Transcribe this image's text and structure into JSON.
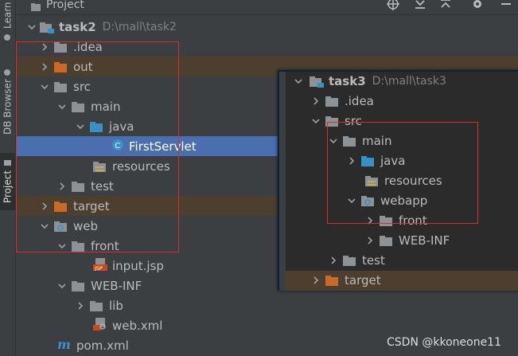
{
  "side_tabs": {
    "learn": "Learn",
    "db_browser": "DB Browser",
    "project": "Project"
  },
  "header": {
    "title": "Project"
  },
  "tree": {
    "root_name": "task2",
    "root_path": "D:\\mall\\task2",
    "idea": ".idea",
    "out": "out",
    "src": "src",
    "main": "main",
    "java": "java",
    "first_servlet": "FirstServlet",
    "resources": "resources",
    "test": "test",
    "target": "target",
    "web": "web",
    "front": "front",
    "input_jsp": "input.jsp",
    "web_inf": "WEB-INF",
    "lib": "lib",
    "web_xml": "web.xml",
    "pom_xml": "pom.xml"
  },
  "overlay_tree": {
    "root_name": "task3",
    "root_path": "D:\\mall\\task3",
    "idea": ".idea",
    "src": "src",
    "main": "main",
    "java": "java",
    "resources": "resources",
    "webapp": "webapp",
    "front": "front",
    "web_inf": "WEB-INF",
    "test": "test",
    "target": "target"
  },
  "watermark": "CSDN @kkoneone11",
  "colors": {
    "selection": "#4b6eaf",
    "excluded_bg": "#4c3f2e",
    "folder_gray": "#8d9296",
    "folder_blue": "#3592c4",
    "folder_orange": "#c86a2a",
    "annotation_red": "#d23030"
  }
}
